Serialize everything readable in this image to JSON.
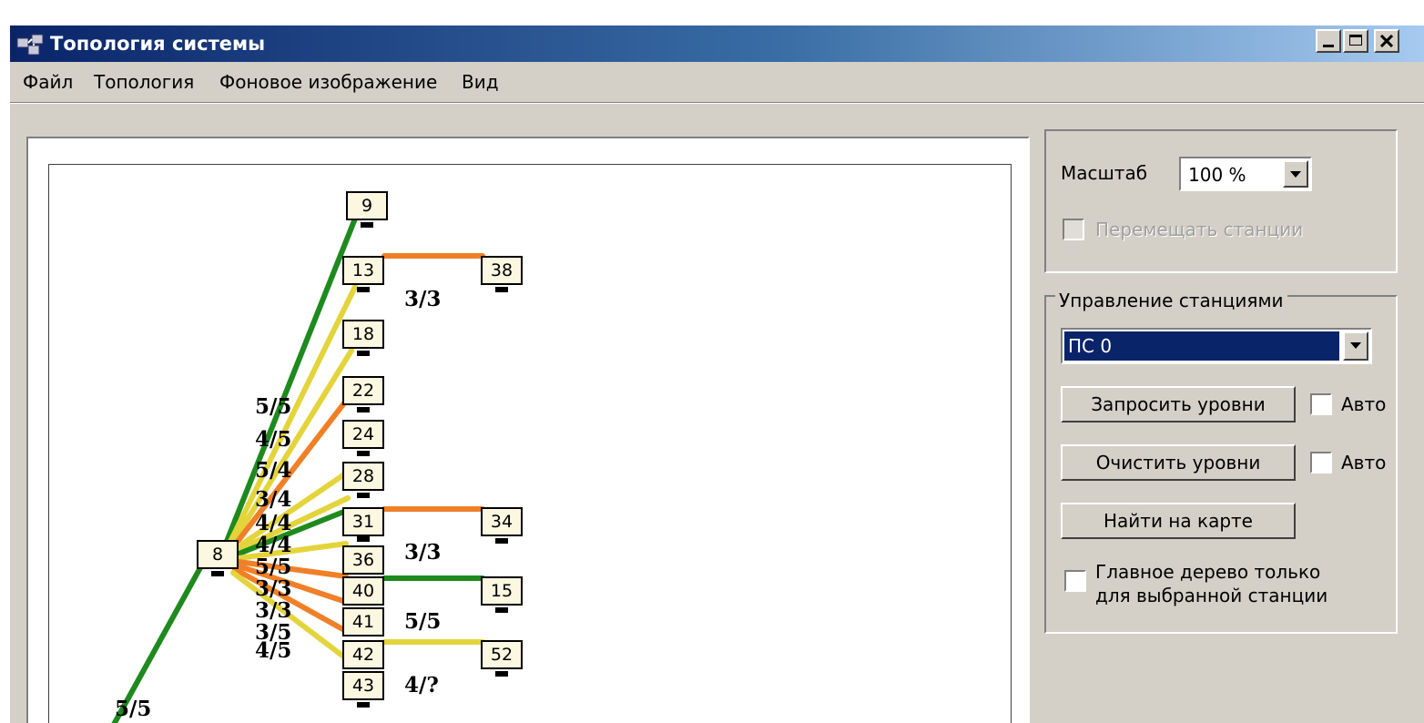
{
  "window": {
    "title": "Топология системы",
    "controls": [
      "minimize",
      "maximize",
      "close"
    ]
  },
  "menu": [
    "Файл",
    "Топология",
    "Фоновое изображение",
    "Вид"
  ],
  "colors": {
    "link_green": "#1e8a1e",
    "link_yellow": "#e4d43c",
    "link_orange": "#f08028",
    "title_bar": "#0a246a",
    "selected_station": "#0a246a"
  },
  "topology": {
    "nodes": [
      "9",
      "13",
      "38",
      "18",
      "22",
      "24",
      "28",
      "31",
      "34",
      "8",
      "36",
      "40",
      "15",
      "41",
      "42",
      "52",
      "43"
    ],
    "link_labels": [
      "3/3",
      "5/5",
      "4/5",
      "5/4",
      "3/4",
      "4/4",
      "4/4",
      "5/5",
      "3/3",
      "3/3",
      "3/5",
      "4/5",
      "3/3",
      "5/5",
      "4/?",
      "5/5"
    ]
  },
  "scale": {
    "label": "Масштаб",
    "value": "100 %",
    "move_stations_label": "Перемещать станции"
  },
  "stations": {
    "group_label": "Управление станциями",
    "selected": "ПС 0",
    "request_button": "Запросить уровни",
    "clear_button": "Очистить уровни",
    "find_button": "Найти на карте",
    "auto_label": "Авто",
    "main_tree_label_line1": "Главное дерево только",
    "main_tree_label_line2": "для выбранной станции"
  }
}
